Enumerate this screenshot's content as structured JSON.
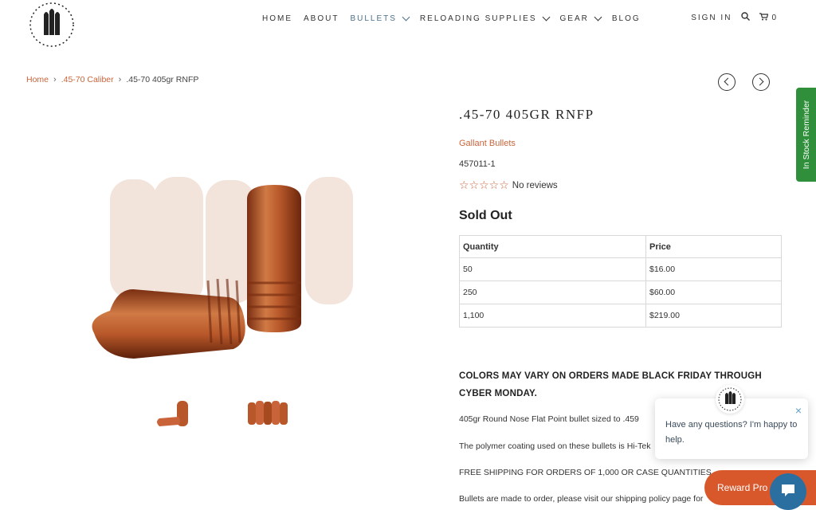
{
  "nav": {
    "items": [
      {
        "label": "HOME",
        "dropdown": false
      },
      {
        "label": "ABOUT",
        "dropdown": false
      },
      {
        "label": "BULLETS",
        "dropdown": true,
        "active": true
      },
      {
        "label": "RELOADING SUPPLIES",
        "dropdown": true
      },
      {
        "label": "GEAR",
        "dropdown": true
      },
      {
        "label": "BLOG",
        "dropdown": false
      }
    ],
    "sign_in": "SIGN IN",
    "cart_count": "0"
  },
  "breadcrumb": {
    "home": "Home",
    "category": ".45-70 Caliber",
    "current": ".45-70 405gr RNFP"
  },
  "product": {
    "title": ".45-70 405GR RNFP",
    "brand": "Gallant Bullets",
    "sku": "457011-1",
    "reviews_label": "No reviews",
    "stars": "☆☆☆☆☆",
    "stock_status": "Sold Out"
  },
  "pricing": {
    "headers": [
      "Quantity",
      "Price"
    ],
    "rows": [
      [
        "50",
        "$16.00"
      ],
      [
        "250",
        "$60.00"
      ],
      [
        "1,100",
        "$219.00"
      ]
    ]
  },
  "description": {
    "notice": "COLORS MAY VARY ON ORDERS MADE BLACK FRIDAY THROUGH CYBER MONDAY.",
    "line1": "405gr Round Nose Flat Point bullet sized to .459",
    "line2": "The polymer coating used on these bullets is Hi-Tek",
    "line3": "FREE SHIPPING FOR ORDERS OF 1,000 OR CASE QUANTITIES",
    "line4": "Bullets are made to order, please visit our shipping policy page for"
  },
  "chat": {
    "message": "Have any questions? I'm happy to help.",
    "close": "×"
  },
  "reward_label": "Reward Pro",
  "in_stock_label": "In Stock Reminder",
  "colors": {
    "accent": "#c9643a",
    "nav_active": "#4a6f8a",
    "reward": "#d9582b",
    "in_stock": "#2f8f3a",
    "chat_bubble": "#2b6fa0"
  }
}
